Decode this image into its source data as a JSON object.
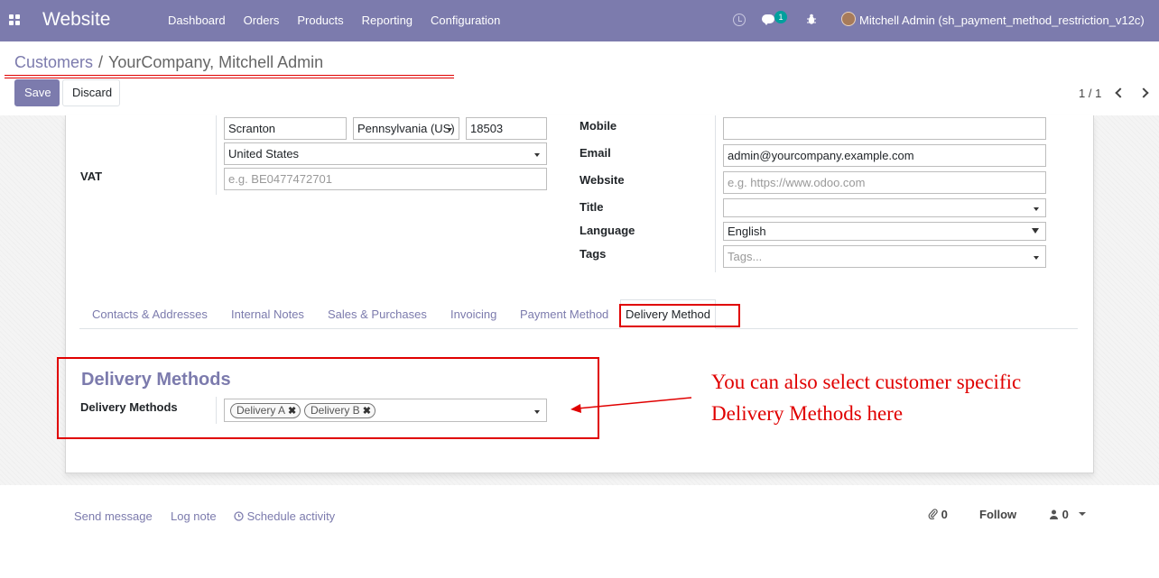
{
  "navbar": {
    "brand": "Website",
    "menu": [
      "Dashboard",
      "Orders",
      "Products",
      "Reporting",
      "Configuration"
    ],
    "messages_badge": "1",
    "user_name": "Mitchell Admin (sh_payment_method_restriction_v12c)",
    "bg_color": "#7c7bad"
  },
  "breadcrumb": {
    "parent": "Customers",
    "separator": "/",
    "current": "YourCompany, Mitchell Admin"
  },
  "buttons": {
    "save": "Save",
    "discard": "Discard"
  },
  "pager": {
    "text": "1 / 1"
  },
  "address": {
    "city": "Scranton",
    "state": "Pennsylvania (US)",
    "zip": "18503",
    "country": "United States",
    "vat_label": "VAT",
    "vat_placeholder": "e.g. BE0477472701"
  },
  "right_fields": {
    "mobile_label": "Mobile",
    "mobile_value": "",
    "email_label": "Email",
    "email_value": "admin@yourcompany.example.com",
    "website_label": "Website",
    "website_placeholder": "e.g. https://www.odoo.com",
    "title_label": "Title",
    "title_value": "",
    "language_label": "Language",
    "language_value": "English",
    "tags_label": "Tags",
    "tags_placeholder": "Tags..."
  },
  "tabs": [
    "Contacts & Addresses",
    "Internal Notes",
    "Sales & Purchases",
    "Invoicing",
    "Payment Method",
    "Delivery Method"
  ],
  "active_tab": "Delivery Method",
  "delivery": {
    "section_title": "Delivery Methods",
    "field_label": "Delivery Methods",
    "tags": [
      "Delivery A",
      "Delivery B"
    ]
  },
  "annotation": {
    "line1": "You can also select customer specific",
    "line2": "Delivery Methods here",
    "color": "#e00000"
  },
  "chatter": {
    "send_message": "Send message",
    "log_note": "Log note",
    "schedule_activity": "Schedule activity",
    "attachments_count": "0",
    "follow": "Follow",
    "followers_count": "0"
  }
}
